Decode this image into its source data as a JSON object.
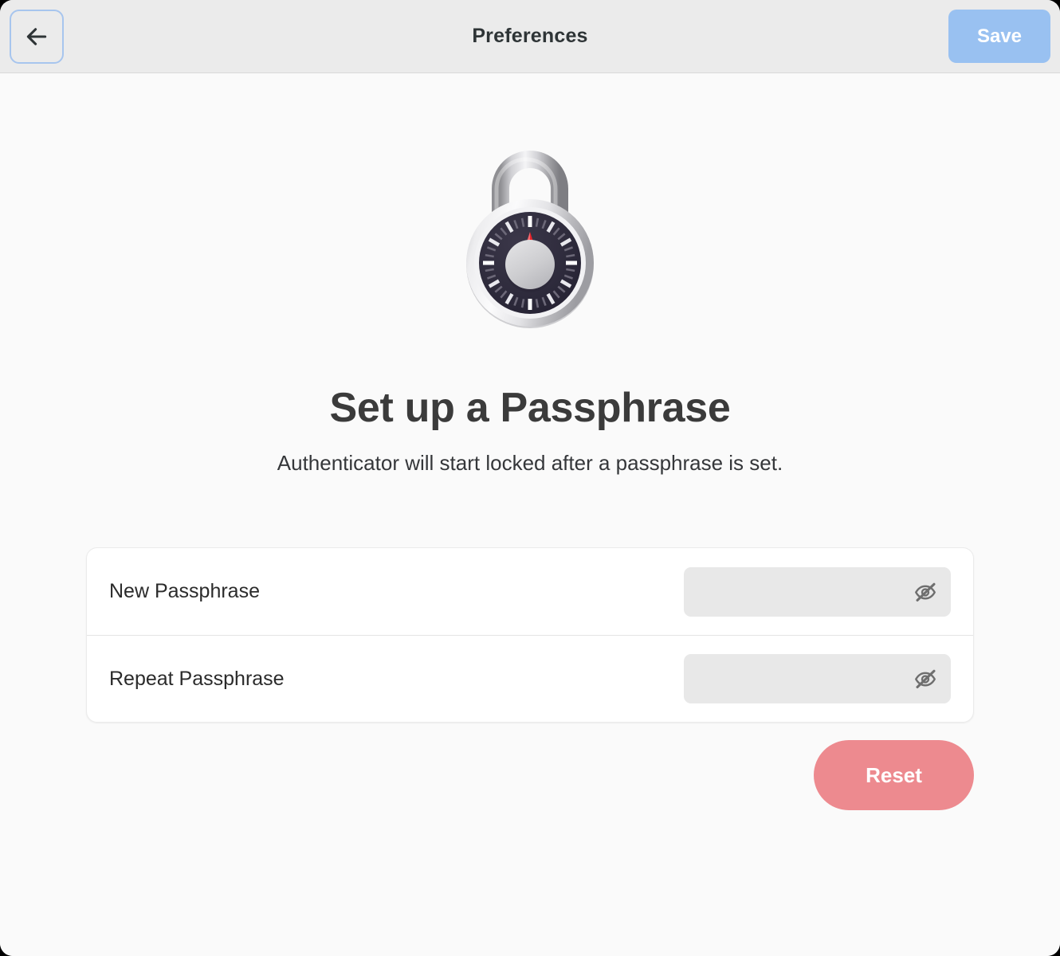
{
  "window": {
    "header": {
      "title": "Preferences",
      "back_button": {
        "label": "Back",
        "icon": "arrow-left-icon"
      },
      "save_button": {
        "label": "Save"
      },
      "background_color": "#ebebeb",
      "accent_color": "#99c1f1"
    },
    "main": {
      "background_color": "#fafafa",
      "illustration": {
        "icon": "combination-padlock-icon",
        "body_color": "#2e2b3d",
        "ring_color": "#d7d7d7",
        "needle_color": "#e8232a",
        "knob_color": "#cfcfcf"
      },
      "title": "Set up a Passphrase",
      "subtitle": "Authenticator will start locked after a passphrase is set.",
      "preferences_card": {
        "rows": [
          {
            "label": "New Passphrase",
            "value": "",
            "placeholder": "",
            "toggle_icon": "eye-slash-icon",
            "masked": true
          },
          {
            "label": "Repeat Passphrase",
            "value": "",
            "placeholder": "",
            "toggle_icon": "eye-slash-icon",
            "masked": true
          }
        ]
      },
      "reset_button": {
        "label": "Reset",
        "color": "#ed8a8f"
      }
    }
  }
}
